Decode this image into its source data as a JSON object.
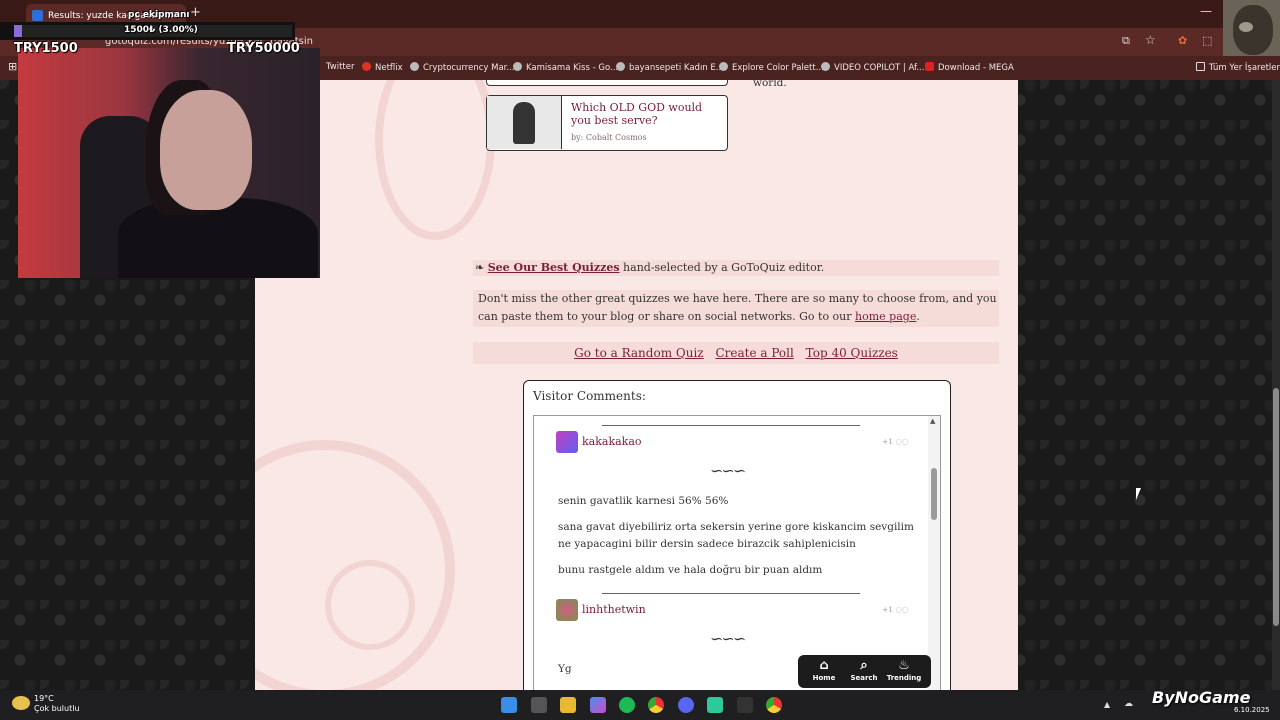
{
  "browser": {
    "tab_title": "Results: yuzde kac gavatsin",
    "address": "gotoquiz.com/results/yuzde_kac_gavatsin",
    "bookmarks": [
      "Twitter",
      "Netflix",
      "Cryptocurrency Mar...",
      "Kamisama Kiss - Go...",
      "bayansepeti Kadın E...",
      "Explore Color Palett...",
      "VIDEO COPILOT | Af...",
      "Download - MEGA",
      "Tüm Yer İşaretleri"
    ]
  },
  "stream_overlay": {
    "goal_title": "pc ekipmanı",
    "goal_progress_text": "1500₺ (3.00%)",
    "goal_progress": 0.03,
    "left_amount": "TRY1500",
    "right_amount": "TRY50000"
  },
  "page": {
    "world_text": "world.",
    "quiz_card": {
      "title": "Which OLD GOD would you best serve?",
      "author": "by: Cobalt Cosmos"
    },
    "best_quizzes": {
      "link": "See Our Best Quizzes",
      "suffix": "hand-selected by a GoToQuiz editor."
    },
    "miss_text_1": "Don't miss the other great quizzes we have here. There are so many to choose from, and you can paste them to your blog or share on social networks. Go to our",
    "home_link": "home page",
    "miss_text_2": ".",
    "links": [
      "Go to a Random Quiz",
      "Create a Poll",
      "Top 40 Quizzes"
    ],
    "comments_title": "Visitor Comments:",
    "comments": [
      {
        "user": "kakakakao",
        "vote": "+1",
        "lines": [
          "senin gavatlik karnesi 56% 56%",
          "sana gavat diyebiliriz orta sekersin yerine gore kiskancim sevgilim ne yapacagini bilir dersin sadece birazcik sahiplenicisin",
          "bunu rastgele aldım ve hala doğru bir puan aldım"
        ]
      },
      {
        "user": "linhthetwin",
        "vote": "+1",
        "lines": [
          "Yg"
        ]
      }
    ]
  },
  "bottom_nav": {
    "home": "Home",
    "search": "Search",
    "trending": "Trending"
  },
  "taskbar": {
    "temp": "19°C",
    "weather": "Çok bulutlu",
    "date": "6.10.2025"
  },
  "watermark": "ByNoGame",
  "colors": {
    "accent": "#7a1e3a",
    "page_bg": "#fae8e6",
    "browser": "#5b2a26"
  }
}
